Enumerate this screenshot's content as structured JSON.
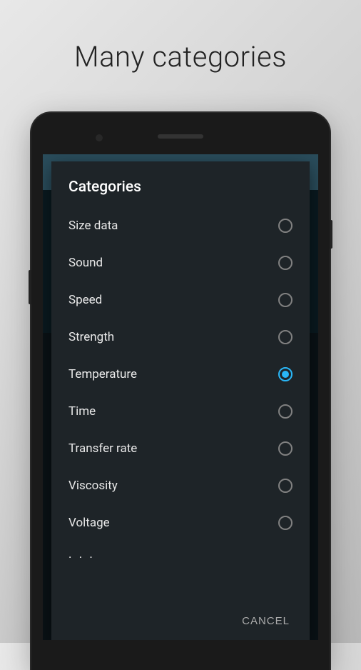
{
  "page": {
    "title": "Many categories"
  },
  "dialog": {
    "title": "Categories",
    "items": [
      {
        "label": "Size data",
        "selected": false
      },
      {
        "label": "Sound",
        "selected": false
      },
      {
        "label": "Speed",
        "selected": false
      },
      {
        "label": "Strength",
        "selected": false
      },
      {
        "label": "Temperature",
        "selected": true
      },
      {
        "label": "Time",
        "selected": false
      },
      {
        "label": "Transfer rate",
        "selected": false
      },
      {
        "label": "Viscosity",
        "selected": false
      },
      {
        "label": "Voltage",
        "selected": false
      }
    ],
    "cancel_label": "CANCEL"
  }
}
